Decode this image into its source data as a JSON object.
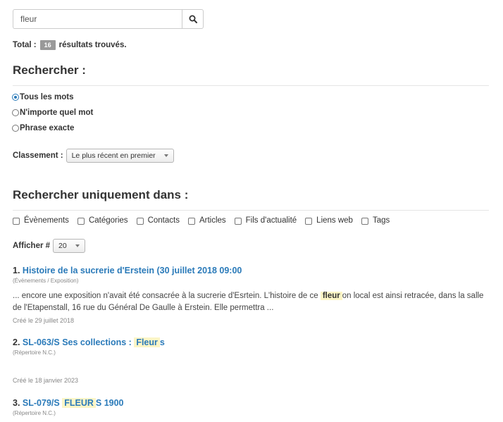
{
  "search": {
    "value": "fleur"
  },
  "total": {
    "label": "Total :",
    "count": "16",
    "suffix": "résultats trouvés."
  },
  "search_for": {
    "title": "Rechercher :",
    "options": [
      {
        "label": "Tous les mots",
        "checked": true
      },
      {
        "label": "N'importe quel mot",
        "checked": false
      },
      {
        "label": "Phrase exacte",
        "checked": false
      }
    ]
  },
  "ordering": {
    "label": "Classement :",
    "selected": "Le plus récent en premier"
  },
  "search_only": {
    "title": "Rechercher uniquement dans :",
    "areas": [
      "Évènements",
      "Catégories",
      "Contacts",
      "Articles",
      "Fils d'actualité",
      "Liens web",
      "Tags"
    ]
  },
  "limit": {
    "label": "Afficher #",
    "selected": "20"
  },
  "results": [
    {
      "num": "1.",
      "title": "Histoire de la sucrerie d'Erstein (30 juillet 2018 09:00",
      "category": "(Évènements / Exposition)",
      "snippet_before": "... encore une exposition n'avait été consacrée à la sucrerie d'Esrtein. L'histoire de ce",
      "snippet_highlight": "fleur",
      "snippet_after": "on local est ainsi retracée, dans la salle de l'Etapenstall, 16 rue du Général De Gaulle à Erstein. Elle permettra ...",
      "created": "Créé le 29 juillet 2018"
    },
    {
      "num": "2.",
      "title_before": "SL-063/S Ses collections :",
      "title_highlight": "Fleur",
      "title_after": "s",
      "category": "(Répertoire N.C.)",
      "created": "Créé le 18 janvier 2023"
    },
    {
      "num": "3.",
      "title_before": "SL-079/S",
      "title_highlight": "FLEUR",
      "title_after": "S 1900",
      "category": "(Répertoire N.C.)"
    }
  ],
  "icons": {
    "search": "search-icon"
  },
  "colors": {
    "link": "#2a7ab9",
    "highlight": "#fcf5c6",
    "badge": "#999999"
  }
}
